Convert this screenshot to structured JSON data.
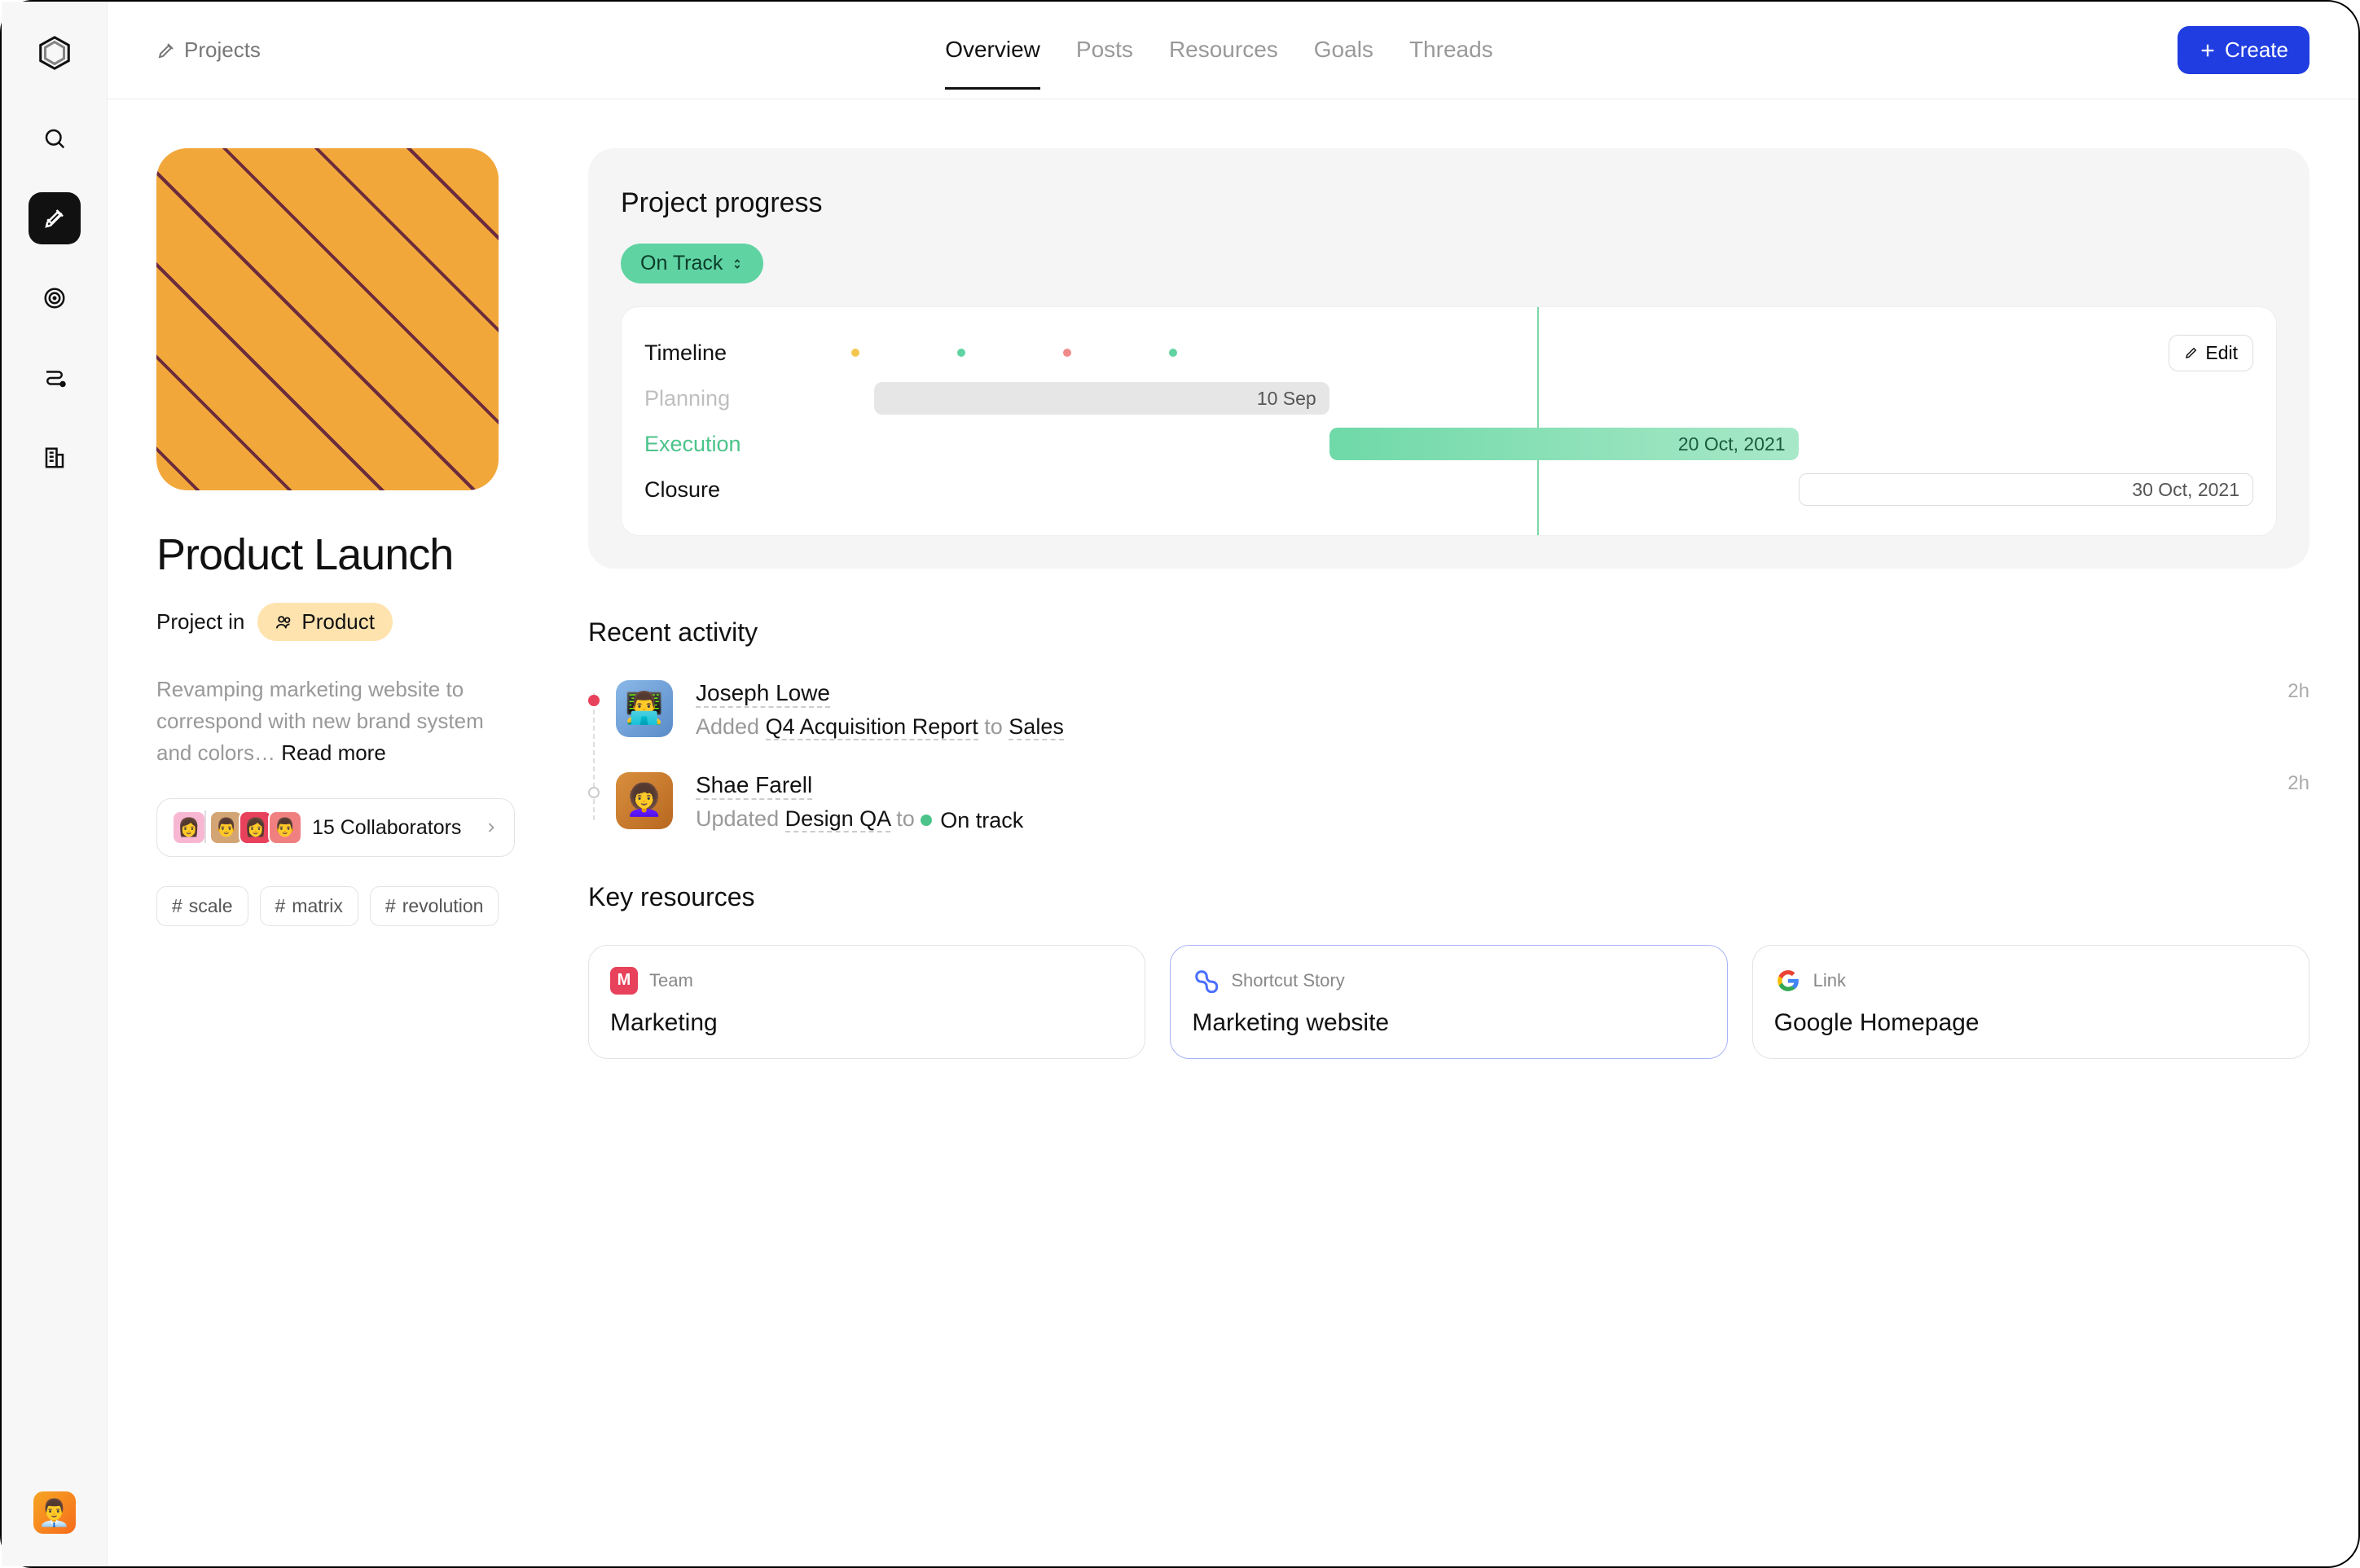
{
  "breadcrumb": {
    "label": "Projects"
  },
  "tabs": [
    "Overview",
    "Posts",
    "Resources",
    "Goals",
    "Threads"
  ],
  "active_tab": "Overview",
  "create_label": "Create",
  "project": {
    "title": "Product Launch",
    "in_label": "Project in",
    "space": "Product",
    "description": "Revamping marketing website to correspond with new brand system and colors… ",
    "read_more": "Read more",
    "collaborators": "15 Collaborators",
    "tags": [
      "scale",
      "matrix",
      "revolution"
    ]
  },
  "progress": {
    "title": "Project progress",
    "status": "On Track",
    "edit": "Edit",
    "rows": {
      "header": "Timeline",
      "planning": {
        "label": "Planning",
        "date": "10 Sep"
      },
      "execution": {
        "label": "Execution",
        "date": "20 Oct, 2021"
      },
      "closure": {
        "label": "Closure",
        "date": "30 Oct, 2021"
      }
    }
  },
  "activity": {
    "title": "Recent activity",
    "items": [
      {
        "name": "Joseph Lowe",
        "verb": "Added",
        "obj": "Q4 Acquisition Report",
        "conn": "to",
        "target": "Sales",
        "time": "2h",
        "type": "link"
      },
      {
        "name": "Shae Farell",
        "verb": "Updated",
        "obj": "Design QA",
        "conn": "to",
        "target": "On track",
        "time": "2h",
        "type": "status"
      }
    ]
  },
  "resources": {
    "title": "Key resources",
    "cards": [
      {
        "kind": "Team",
        "title": "Marketing",
        "icon": "M"
      },
      {
        "kind": "Shortcut Story",
        "title": "Marketing website",
        "icon": "S"
      },
      {
        "kind": "Link",
        "title": "Google Homepage",
        "icon": "G"
      }
    ]
  }
}
